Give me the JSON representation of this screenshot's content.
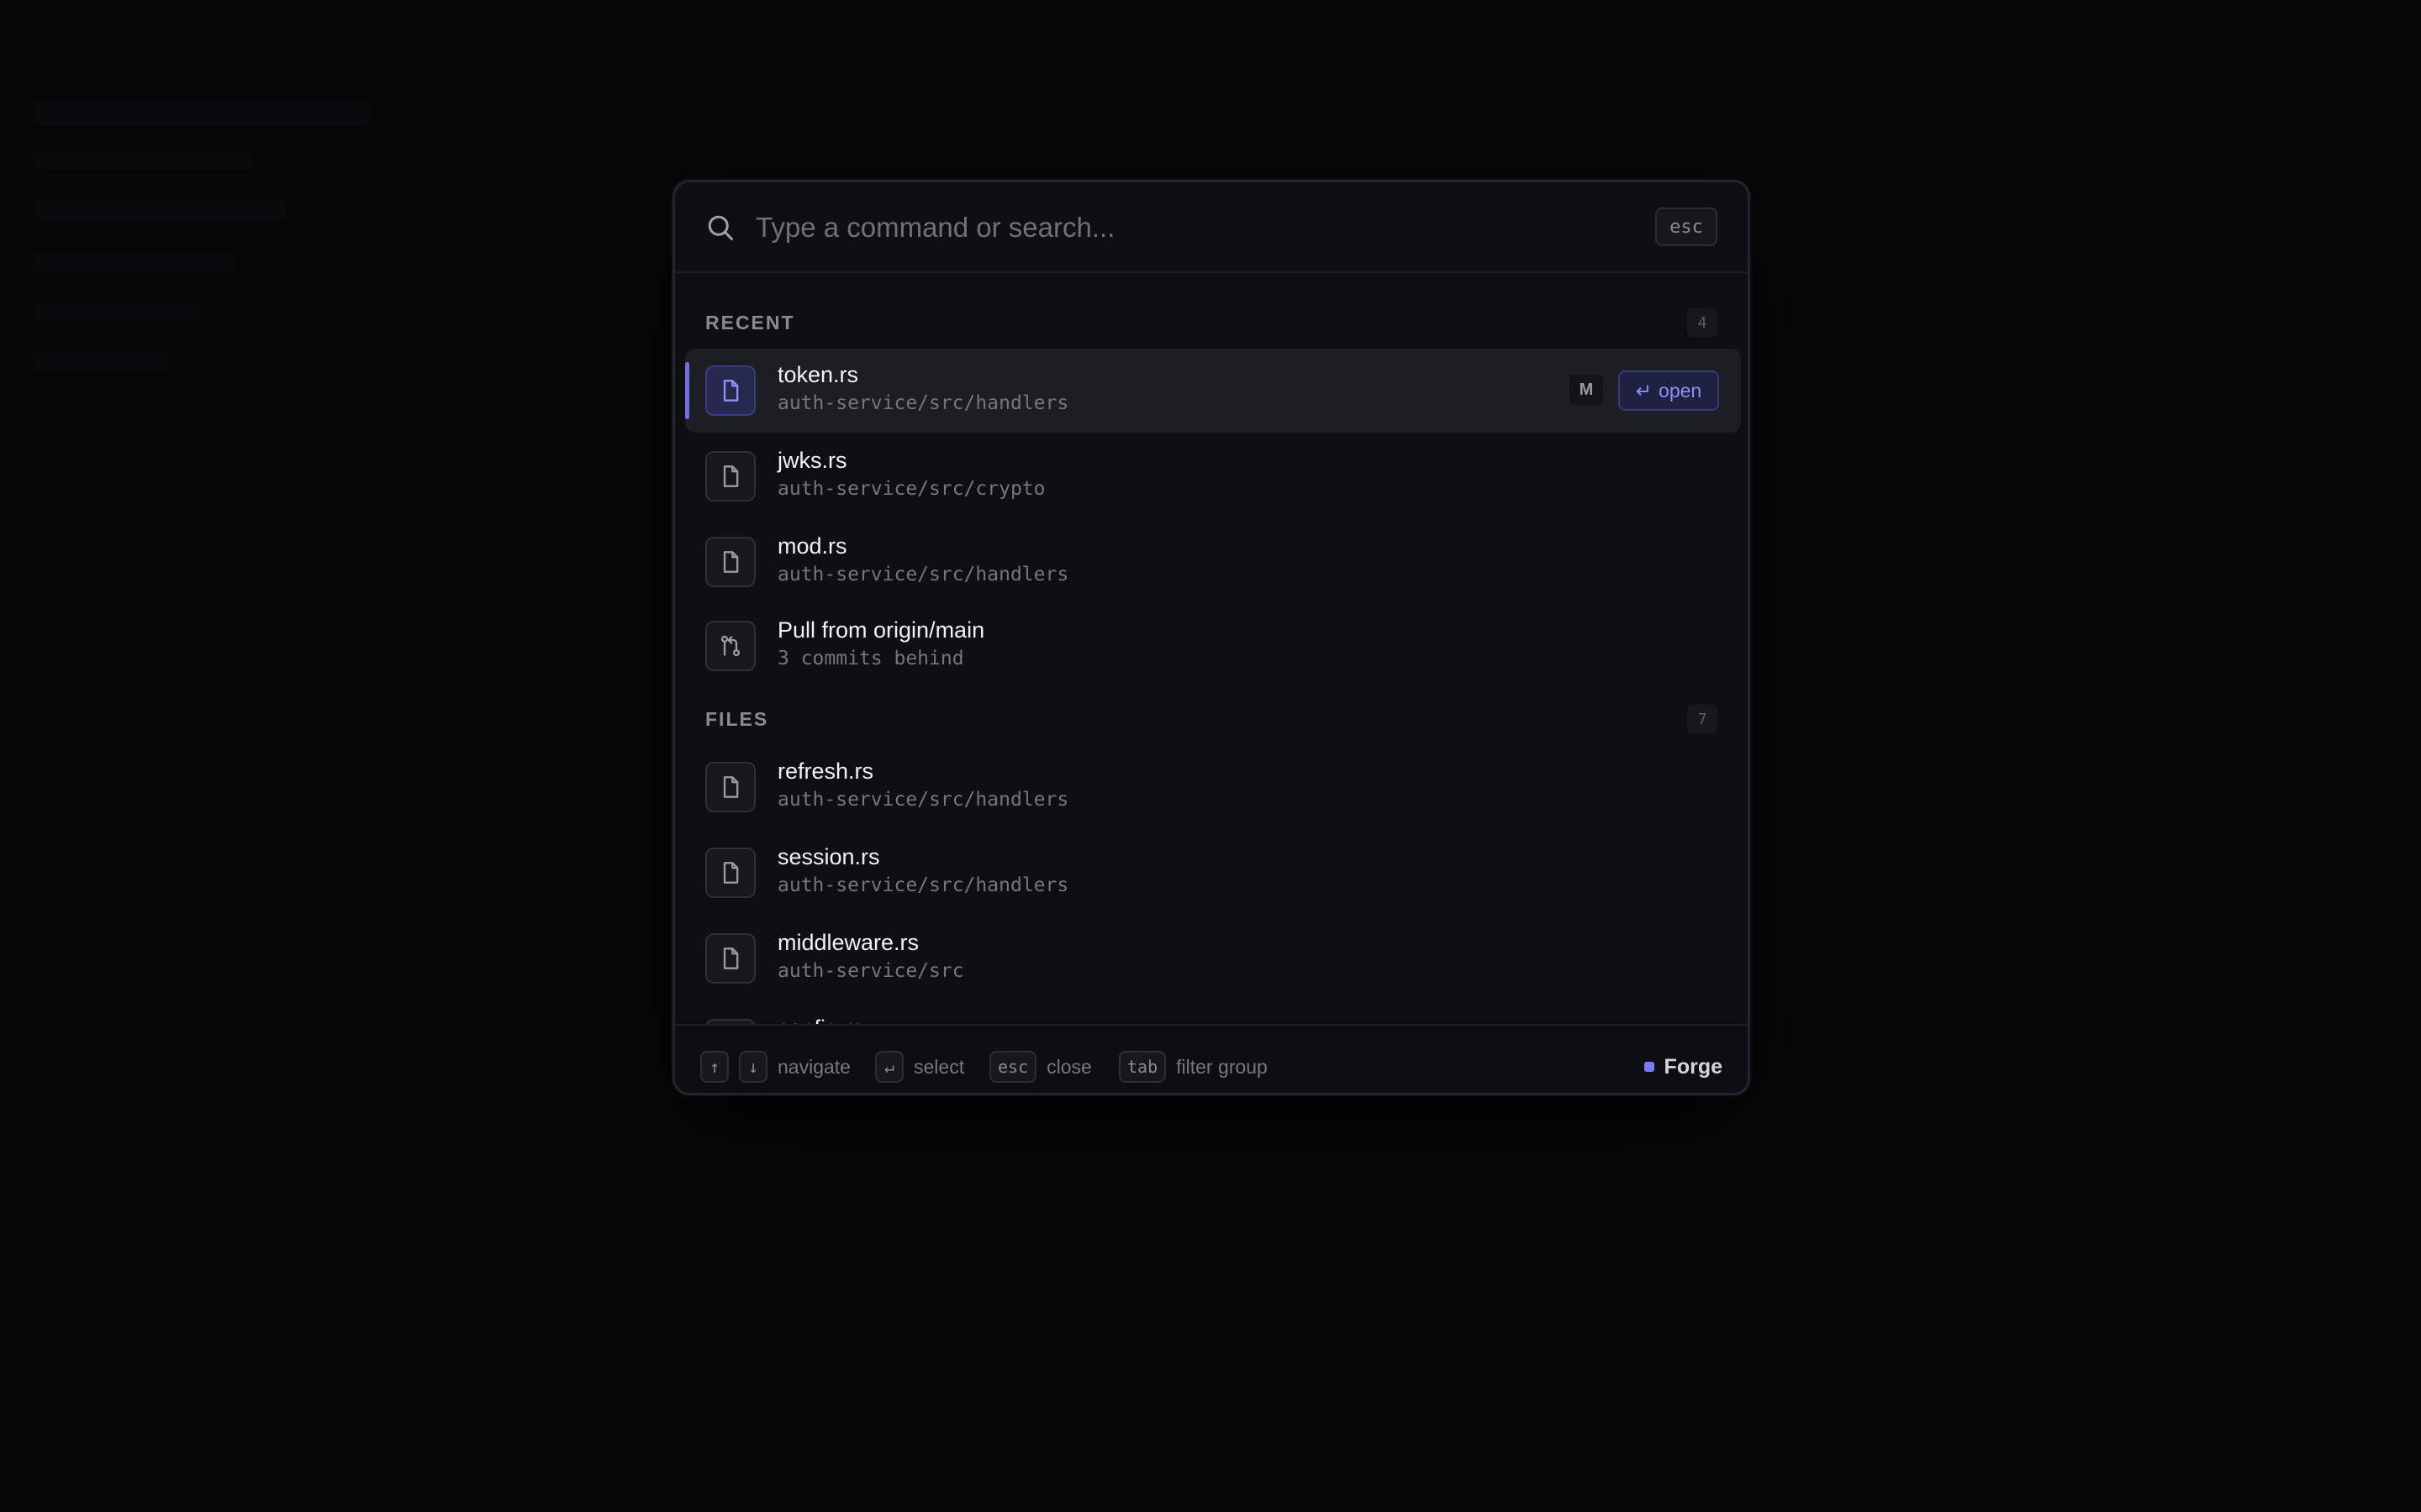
{
  "search": {
    "placeholder": "Type a command or search...",
    "value": "",
    "close_key": "esc"
  },
  "groups": [
    {
      "title": "RECENT",
      "count": "4"
    },
    {
      "title": "FILES",
      "count": "7"
    }
  ],
  "recent_items": [
    {
      "icon": "file-icon",
      "title": "token.rs",
      "subtitle": "auth-service/src/handlers",
      "selected": true,
      "badge": "M",
      "action": "open"
    },
    {
      "icon": "file-icon",
      "title": "jwks.rs",
      "subtitle": "auth-service/src/crypto"
    },
    {
      "icon": "file-icon",
      "title": "mod.rs",
      "subtitle": "auth-service/src/handlers"
    },
    {
      "icon": "git-pull-request-icon",
      "title": "Pull from origin/main",
      "subtitle": "3 commits behind"
    }
  ],
  "file_items": [
    {
      "icon": "file-icon",
      "title": "refresh.rs",
      "subtitle": "auth-service/src/handlers"
    },
    {
      "icon": "file-icon",
      "title": "session.rs",
      "subtitle": "auth-service/src/handlers"
    },
    {
      "icon": "file-icon",
      "title": "middleware.rs",
      "subtitle": "auth-service/src"
    },
    {
      "icon": "file-icon",
      "title": "config.rs",
      "subtitle": ""
    }
  ],
  "footer": {
    "hints": [
      {
        "keys": [
          "↑",
          "↓"
        ],
        "label": "navigate"
      },
      {
        "keys": [
          "↵"
        ],
        "label": "select"
      },
      {
        "keys": [
          "esc"
        ],
        "label": "close"
      },
      {
        "keys": [
          "tab"
        ],
        "label": "filter group"
      }
    ],
    "brand": "Forge"
  },
  "colors": {
    "accent": "#6f6ef0",
    "background": "#080809",
    "panel": "#0e0f12"
  }
}
